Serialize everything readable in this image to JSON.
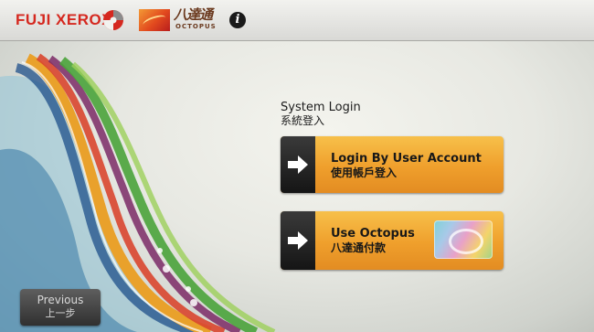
{
  "header": {
    "brand": "FUJI XEROX",
    "partner_logo_cn": "八達通",
    "partner_logo_en": "OCTOPUS",
    "info_glyph": "i"
  },
  "login": {
    "title_en": "System Login",
    "title_cn": "系統登入"
  },
  "buttons": {
    "user_account_en": "Login By User Account",
    "user_account_cn": "使用帳戶登入",
    "octopus_en": "Use Octopus",
    "octopus_cn": "八達通付款"
  },
  "footer": {
    "previous_en": "Previous",
    "previous_cn": "上一步"
  },
  "colors": {
    "brand_red": "#d5281f",
    "button_orange": "#ef9f2c",
    "arrow_box": "#1f1f1f"
  },
  "icons": [
    "fuji-xerox-mark-icon",
    "octopus-logo-icon",
    "info-icon",
    "arrow-right-icon",
    "octopus-card-icon"
  ]
}
